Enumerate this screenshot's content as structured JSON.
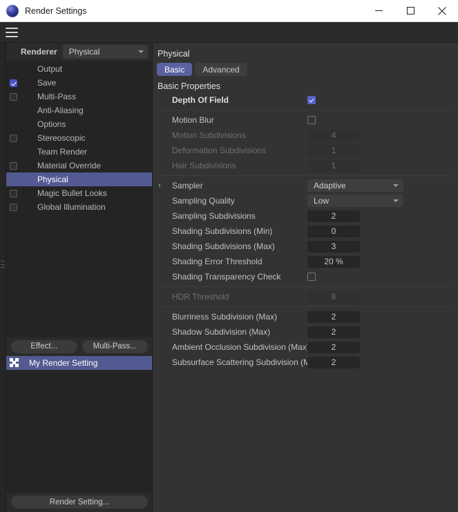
{
  "window": {
    "title": "Render Settings",
    "icon": "c4d-sphere-icon",
    "minimize_label": "─",
    "maximize_label": "□",
    "close_label": "✕"
  },
  "menubar": {
    "menu_icon": "hamburger-menu-icon"
  },
  "sidebar": {
    "renderer_label": "Renderer",
    "renderer_value": "Physical",
    "items": [
      {
        "label": "Output",
        "checkbox": "none",
        "selected": false
      },
      {
        "label": "Save",
        "checkbox": "checked",
        "selected": false
      },
      {
        "label": "Multi-Pass",
        "checkbox": "unchecked",
        "selected": false
      },
      {
        "label": "Anti-Aliasing",
        "checkbox": "none",
        "selected": false
      },
      {
        "label": "Options",
        "checkbox": "none",
        "selected": false
      },
      {
        "label": "Stereoscopic",
        "checkbox": "unchecked",
        "selected": false
      },
      {
        "label": "Team Render",
        "checkbox": "none",
        "selected": false
      },
      {
        "label": "Material Override",
        "checkbox": "unchecked",
        "selected": false
      },
      {
        "label": "Physical",
        "checkbox": "none",
        "selected": true
      },
      {
        "label": "Magic Bullet Looks",
        "checkbox": "unchecked",
        "selected": false
      },
      {
        "label": "Global Illumination",
        "checkbox": "unchecked",
        "selected": false
      }
    ],
    "effect_button": "Effect...",
    "multipass_button": "Multi-Pass...",
    "render_setting_item": "My Render Setting",
    "render_setting_icon": "render-preset-icon",
    "bottom_button": "Render Setting..."
  },
  "main": {
    "title": "Physical",
    "tabs": [
      {
        "label": "Basic",
        "active": true
      },
      {
        "label": "Advanced",
        "active": false
      }
    ],
    "group_title": "Basic Properties",
    "rows": [
      {
        "label": "Depth Of Field",
        "type": "checkbox",
        "value": "checked",
        "disabled": false,
        "bold": true,
        "arrow": false,
        "sep_after": true
      },
      {
        "label": "Motion Blur",
        "type": "checkbox",
        "value": "unchecked",
        "disabled": false,
        "bold": false,
        "arrow": false,
        "sep_after": false
      },
      {
        "label": "Motion Subdivisions",
        "type": "field",
        "value": "4",
        "disabled": true,
        "bold": false,
        "arrow": false,
        "sep_after": false
      },
      {
        "label": "Deformation Subdivisions",
        "type": "field",
        "value": "1",
        "disabled": true,
        "bold": false,
        "arrow": false,
        "sep_after": false
      },
      {
        "label": "Hair Subdivisions",
        "type": "field",
        "value": "1",
        "disabled": true,
        "bold": false,
        "arrow": false,
        "sep_after": true
      },
      {
        "label": "Sampler",
        "type": "dropdown",
        "value": "Adaptive",
        "disabled": false,
        "bold": false,
        "arrow": true,
        "sep_after": false
      },
      {
        "label": "Sampling Quality",
        "type": "dropdown",
        "value": "Low",
        "disabled": false,
        "bold": false,
        "arrow": false,
        "sep_after": false
      },
      {
        "label": "Sampling Subdivisions",
        "type": "field",
        "value": "2",
        "disabled": false,
        "bold": false,
        "arrow": false,
        "sep_after": false
      },
      {
        "label": "Shading Subdivisions (Min)",
        "type": "field",
        "value": "0",
        "disabled": false,
        "bold": false,
        "arrow": false,
        "sep_after": false
      },
      {
        "label": "Shading Subdivisions (Max)",
        "type": "field",
        "value": "3",
        "disabled": false,
        "bold": false,
        "arrow": false,
        "sep_after": false
      },
      {
        "label": "Shading Error Threshold",
        "type": "field",
        "value": "20 %",
        "disabled": false,
        "bold": false,
        "arrow": false,
        "sep_after": false
      },
      {
        "label": "Shading Transparency Check",
        "type": "checkbox",
        "value": "unchecked",
        "disabled": false,
        "bold": false,
        "arrow": false,
        "sep_after": true
      },
      {
        "label": "HDR Threshold",
        "type": "field",
        "value": "8",
        "disabled": true,
        "bold": false,
        "arrow": false,
        "sep_after": true
      },
      {
        "label": "Blurriness Subdivision (Max)",
        "type": "field",
        "value": "2",
        "disabled": false,
        "bold": false,
        "arrow": false,
        "sep_after": false
      },
      {
        "label": "Shadow Subdivision (Max)",
        "type": "field",
        "value": "2",
        "disabled": false,
        "bold": false,
        "arrow": false,
        "sep_after": false
      },
      {
        "label": "Ambient Occlusion Subdivision (Max)",
        "type": "field",
        "value": "2",
        "disabled": false,
        "bold": false,
        "arrow": false,
        "sep_after": false
      },
      {
        "label": "Subsurface Scattering Subdivision (Max)",
        "type": "field",
        "value": "2",
        "disabled": false,
        "bold": false,
        "arrow": false,
        "sep_after": false
      }
    ]
  },
  "colors": {
    "accent": "#535a91",
    "tab_active": "#5a61a0",
    "checkbox_on": "#5a61c9",
    "panel_bg": "#333333",
    "sidebar_bg": "#2b2b2b",
    "tree_bg": "#242424"
  }
}
